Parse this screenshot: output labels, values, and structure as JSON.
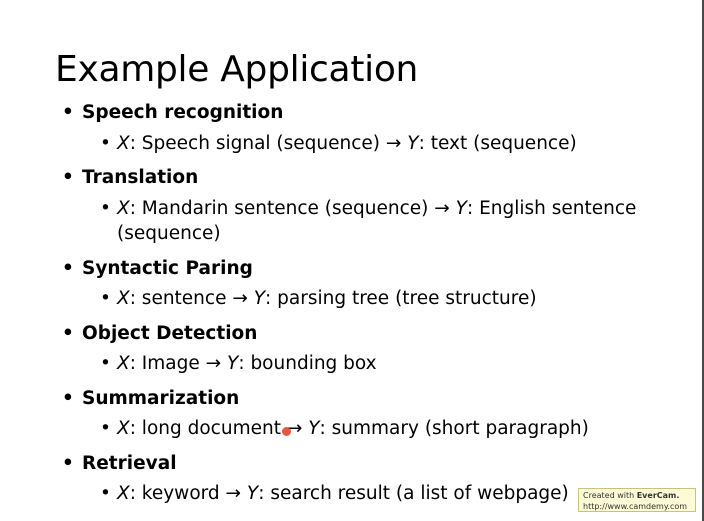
{
  "title": "Example Application",
  "bullets": [
    {
      "heading": "Speech recognition",
      "sub": {
        "x": "X",
        "x_text": ": Speech signal (sequence) → ",
        "y": "Y",
        "y_text": ": text (sequence)"
      }
    },
    {
      "heading": "Translation",
      "sub": {
        "x": "X",
        "x_text": ": Mandarin sentence (sequence) → ",
        "y": "Y",
        "y_text": ": English sentence",
        "cont": "(sequence)"
      }
    },
    {
      "heading": "Syntactic Paring",
      "sub": {
        "x": "X",
        "x_text": ": sentence → ",
        "y": "Y",
        "y_text": ": parsing tree (tree structure)"
      }
    },
    {
      "heading": "Object Detection",
      "sub": {
        "x": "X",
        "x_text": ": Image → ",
        "y": "Y",
        "y_text": ": bounding box"
      }
    },
    {
      "heading": "Summarization",
      "sub": {
        "x": "X",
        "x_text": ": long document → ",
        "y": "Y",
        "y_text": ": summary (short paragraph)"
      }
    },
    {
      "heading": "Retrieval",
      "sub": {
        "x": "X",
        "x_text": ": keyword → ",
        "y": "Y",
        "y_text": ": search result (a list of webpage)"
      }
    }
  ],
  "watermark": {
    "prefix": "Created with ",
    "brand": "EverCam.",
    "url": "http://www.camdemy.com"
  }
}
